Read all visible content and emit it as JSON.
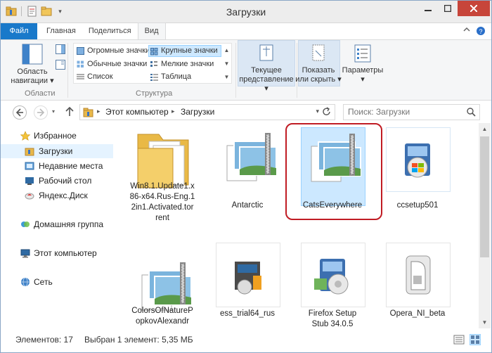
{
  "window": {
    "title": "Загрузки"
  },
  "tabs": [
    "Файл",
    "Главная",
    "Поделиться",
    "Вид"
  ],
  "ribbon": {
    "nav_pane_label": "Область навигации",
    "nav_pane_line1": "Область",
    "nav_pane_line2": "навигации ▾",
    "panes_group": "Области",
    "layout_group": "Структура",
    "layouts": [
      "Огромные значки",
      "Крупные значки",
      "Обычные значки",
      "Мелкие значки",
      "Список",
      "Таблица"
    ],
    "current_view_1": "Текущее",
    "current_view_2": "представление ▾",
    "show_hide_1": "Показать",
    "show_hide_2": "или скрыть ▾",
    "options_1": "Параметры",
    "options_2": "▾"
  },
  "address": {
    "segments": [
      "Этот компьютер",
      "Загрузки"
    ],
    "search_placeholder": "Поиск: Загрузки"
  },
  "navpane": {
    "favorites": "Избранное",
    "downloads": "Загрузки",
    "recent": "Недавние места",
    "desktop": "Рабочий стол",
    "yandex": "Яндекс.Диск",
    "homegroup": "Домашняя группа",
    "computer": "Этот компьютер",
    "network": "Сеть"
  },
  "files": [
    {
      "name_lines": [
        "Win8.1.Update1.x",
        "86-x64.Rus-Eng.1",
        "2in1.Activated.tor",
        "rent"
      ],
      "icon": "folder-icon"
    },
    {
      "name_lines": [
        "Antarctic"
      ],
      "icon": "archive-icon"
    },
    {
      "name_lines": [
        "CatsEverywhere"
      ],
      "icon": "archive-icon",
      "selected": true
    },
    {
      "name_lines": [
        "ccsetup501"
      ],
      "icon": "installer-icon"
    },
    {
      "name_lines": [
        "ColorsOfNatureP",
        "opkovAlexandr"
      ],
      "icon": "archive-icon"
    },
    {
      "name_lines": [
        "ess_trial64_rus"
      ],
      "icon": "installer-icon"
    },
    {
      "name_lines": [
        "Firefox Setup",
        "Stub 34.0.5"
      ],
      "icon": "installer-icon"
    },
    {
      "name_lines": [
        "Opera_NI_beta"
      ],
      "icon": "installer-icon"
    }
  ],
  "status": {
    "count": "Элементов: 17",
    "selection": "Выбран 1 элемент: 5,35 МБ"
  },
  "colors": {
    "file_tab": "#1979ca",
    "selection": "#cce8ff",
    "highlight_ring": "#c01c24",
    "close_button": "#c7453a"
  }
}
